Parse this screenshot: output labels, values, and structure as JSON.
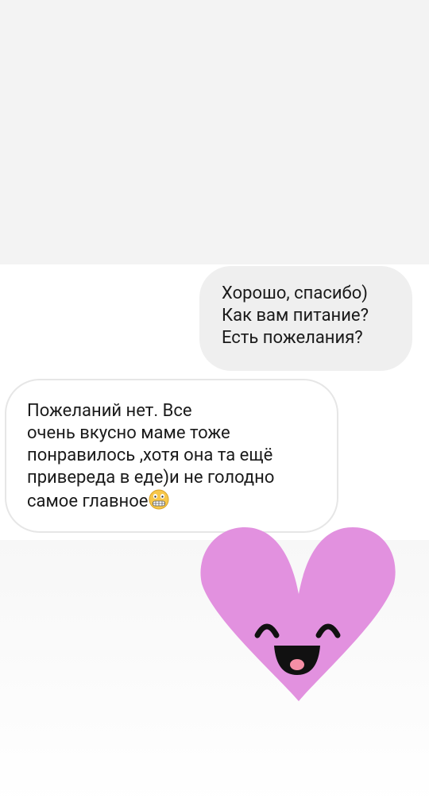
{
  "conversation": {
    "outgoing_message": "Хорошо, спасибо)\nКак вам питание?\nЕсть пожелания?",
    "incoming_message": "Пожеланий нет. Все\nочень вкусно маме тоже\nпонравилось ,хотя она та ещё\nпривереда в еде)и не голодно\nсамое главное"
  },
  "emoji": {
    "name": "grimacing-face-icon"
  },
  "sticker": {
    "name": "smiling-heart-sticker",
    "color": "#E291DF"
  },
  "colors": {
    "top_panel": "#F3F3F3",
    "outgoing_bubble": "#EFEFEF",
    "incoming_bubble": "#FFFFFF",
    "incoming_border": "#E6E6E6",
    "text": "#1A1A1A"
  }
}
